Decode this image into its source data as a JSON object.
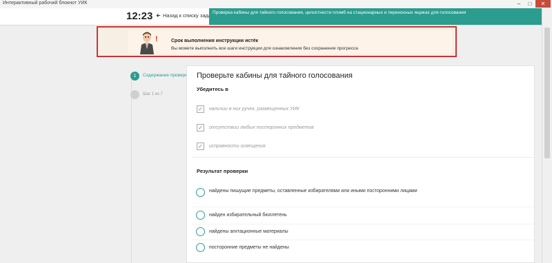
{
  "window": {
    "title": "Интерактивный рабочий блокнот УИК",
    "minimize": "–",
    "maximize": "□",
    "close": "✕"
  },
  "header": {
    "time": "12:23",
    "back_icon": "back-arrow-icon",
    "back_label": "Назад к списку задач",
    "task_title": "Проверка кабины для тайного голосования, целостности пломб на стационарных и переносных ящиках для голосования"
  },
  "alert": {
    "title": "Срок выполнения инструкции истёк",
    "message": "Вы можете выполнить все шаги инструкции для ознакомления без сохранения прогресса",
    "exclamation": "!"
  },
  "steps": [
    {
      "number": "1",
      "label": "Содержание проверки",
      "active": true
    },
    {
      "number": "",
      "label": "Шаг 1 из 7",
      "active": false
    }
  ],
  "check": {
    "title": "Проверьте кабины для тайного голосования",
    "ensure_heading": "Убедитесь в",
    "items": [
      {
        "label": "наличии в них ручек, размещенных УИК",
        "checked": true
      },
      {
        "label": "отсутствии любых посторонних предметов",
        "checked": true
      },
      {
        "label": "исправности освещения",
        "checked": true
      }
    ]
  },
  "result": {
    "heading": "Результат проверки",
    "options": [
      {
        "label": "найдены пишущие предметы, оставленные избирателями или иными посторонними лицами"
      },
      {
        "label": "найден избирательный бюллетень"
      },
      {
        "label": "найдены агитационные материалы"
      },
      {
        "label": "посторонние предметы не найдены"
      }
    ]
  },
  "colors": {
    "accent": "#2a9d8f",
    "alert_border": "#c83535",
    "alert_bg": "#fdf3e8"
  }
}
